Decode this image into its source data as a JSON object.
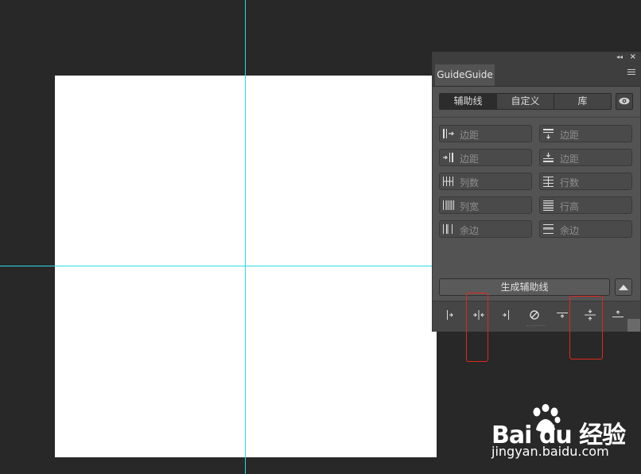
{
  "panel": {
    "tab_title": "GuideGuide",
    "segments": [
      "辅助线",
      "自定义",
      "库"
    ],
    "fields_left": [
      {
        "icon": "left-margin-icon",
        "placeholder": "边距"
      },
      {
        "icon": "right-margin-icon",
        "placeholder": "边距"
      },
      {
        "icon": "columns-icon",
        "placeholder": "列数"
      },
      {
        "icon": "column-width-icon",
        "placeholder": "列宽"
      },
      {
        "icon": "column-gutter-icon",
        "placeholder": "余边"
      }
    ],
    "fields_right": [
      {
        "icon": "top-margin-icon",
        "placeholder": "边距"
      },
      {
        "icon": "bottom-margin-icon",
        "placeholder": "边距"
      },
      {
        "icon": "rows-icon",
        "placeholder": "行数"
      },
      {
        "icon": "row-height-icon",
        "placeholder": "行高"
      },
      {
        "icon": "row-gutter-icon",
        "placeholder": "余边"
      }
    ],
    "generate_label": "生成辅助线",
    "bottom_buttons": [
      "guide-left-icon",
      "guide-vertical-center-icon",
      "guide-right-icon",
      "clear-guides-icon",
      "guide-top-icon",
      "guide-horizontal-center-icon",
      "guide-bottom-icon"
    ]
  },
  "watermark": {
    "brand": "Bai du 经验",
    "url": "jingyan.baidu.com"
  },
  "colors": {
    "background": "#282828",
    "guide": "#2fd8e8",
    "highlight": "#e0281e",
    "panel": "#535353"
  }
}
